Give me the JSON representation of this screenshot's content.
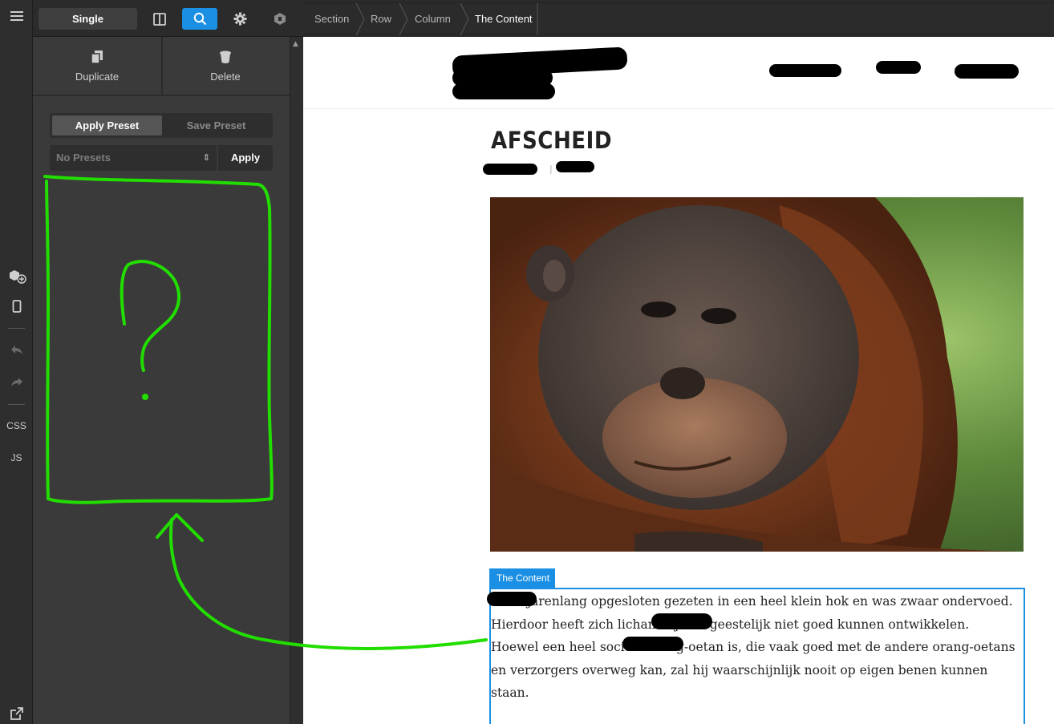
{
  "toolbar": {
    "mode_label": "Single",
    "icons": [
      "hamburger-icon",
      "columns-icon",
      "search-icon",
      "gear-icon",
      "hexagon-icon"
    ]
  },
  "breadcrumbs": [
    "Section",
    "Row",
    "Column",
    "The Content"
  ],
  "rail": {
    "css_label": "CSS",
    "js_label": "JS"
  },
  "panel": {
    "duplicate_label": "Duplicate",
    "delete_label": "Delete",
    "apply_preset_tab": "Apply Preset",
    "save_preset_tab": "Save Preset",
    "preset_select_value": "No Presets",
    "apply_button": "Apply"
  },
  "preview": {
    "page_title": "AFSCHEID",
    "content_tag": "The Content",
    "content_text": "heeft jarenlang opgesloten gezeten in een heel klein hok en was zwaar ondervoed. Hierdoor heeft zich lichamelijk en geestelijk niet goed kunnen ontwikkelen. Hoewel een heel sociale orang-oetan is, die vaak goed met de andere orang-oetans en verzorgers overweg kan, zal hij waarschijnlijk nooit op eigen benen kunnen staan."
  },
  "annotation": {
    "mark": "?",
    "color": "#22dd00"
  },
  "colors": {
    "accent": "#1a8fe3",
    "panel_bg": "#3a3a3a",
    "dark_bg": "#2b2b2b"
  }
}
